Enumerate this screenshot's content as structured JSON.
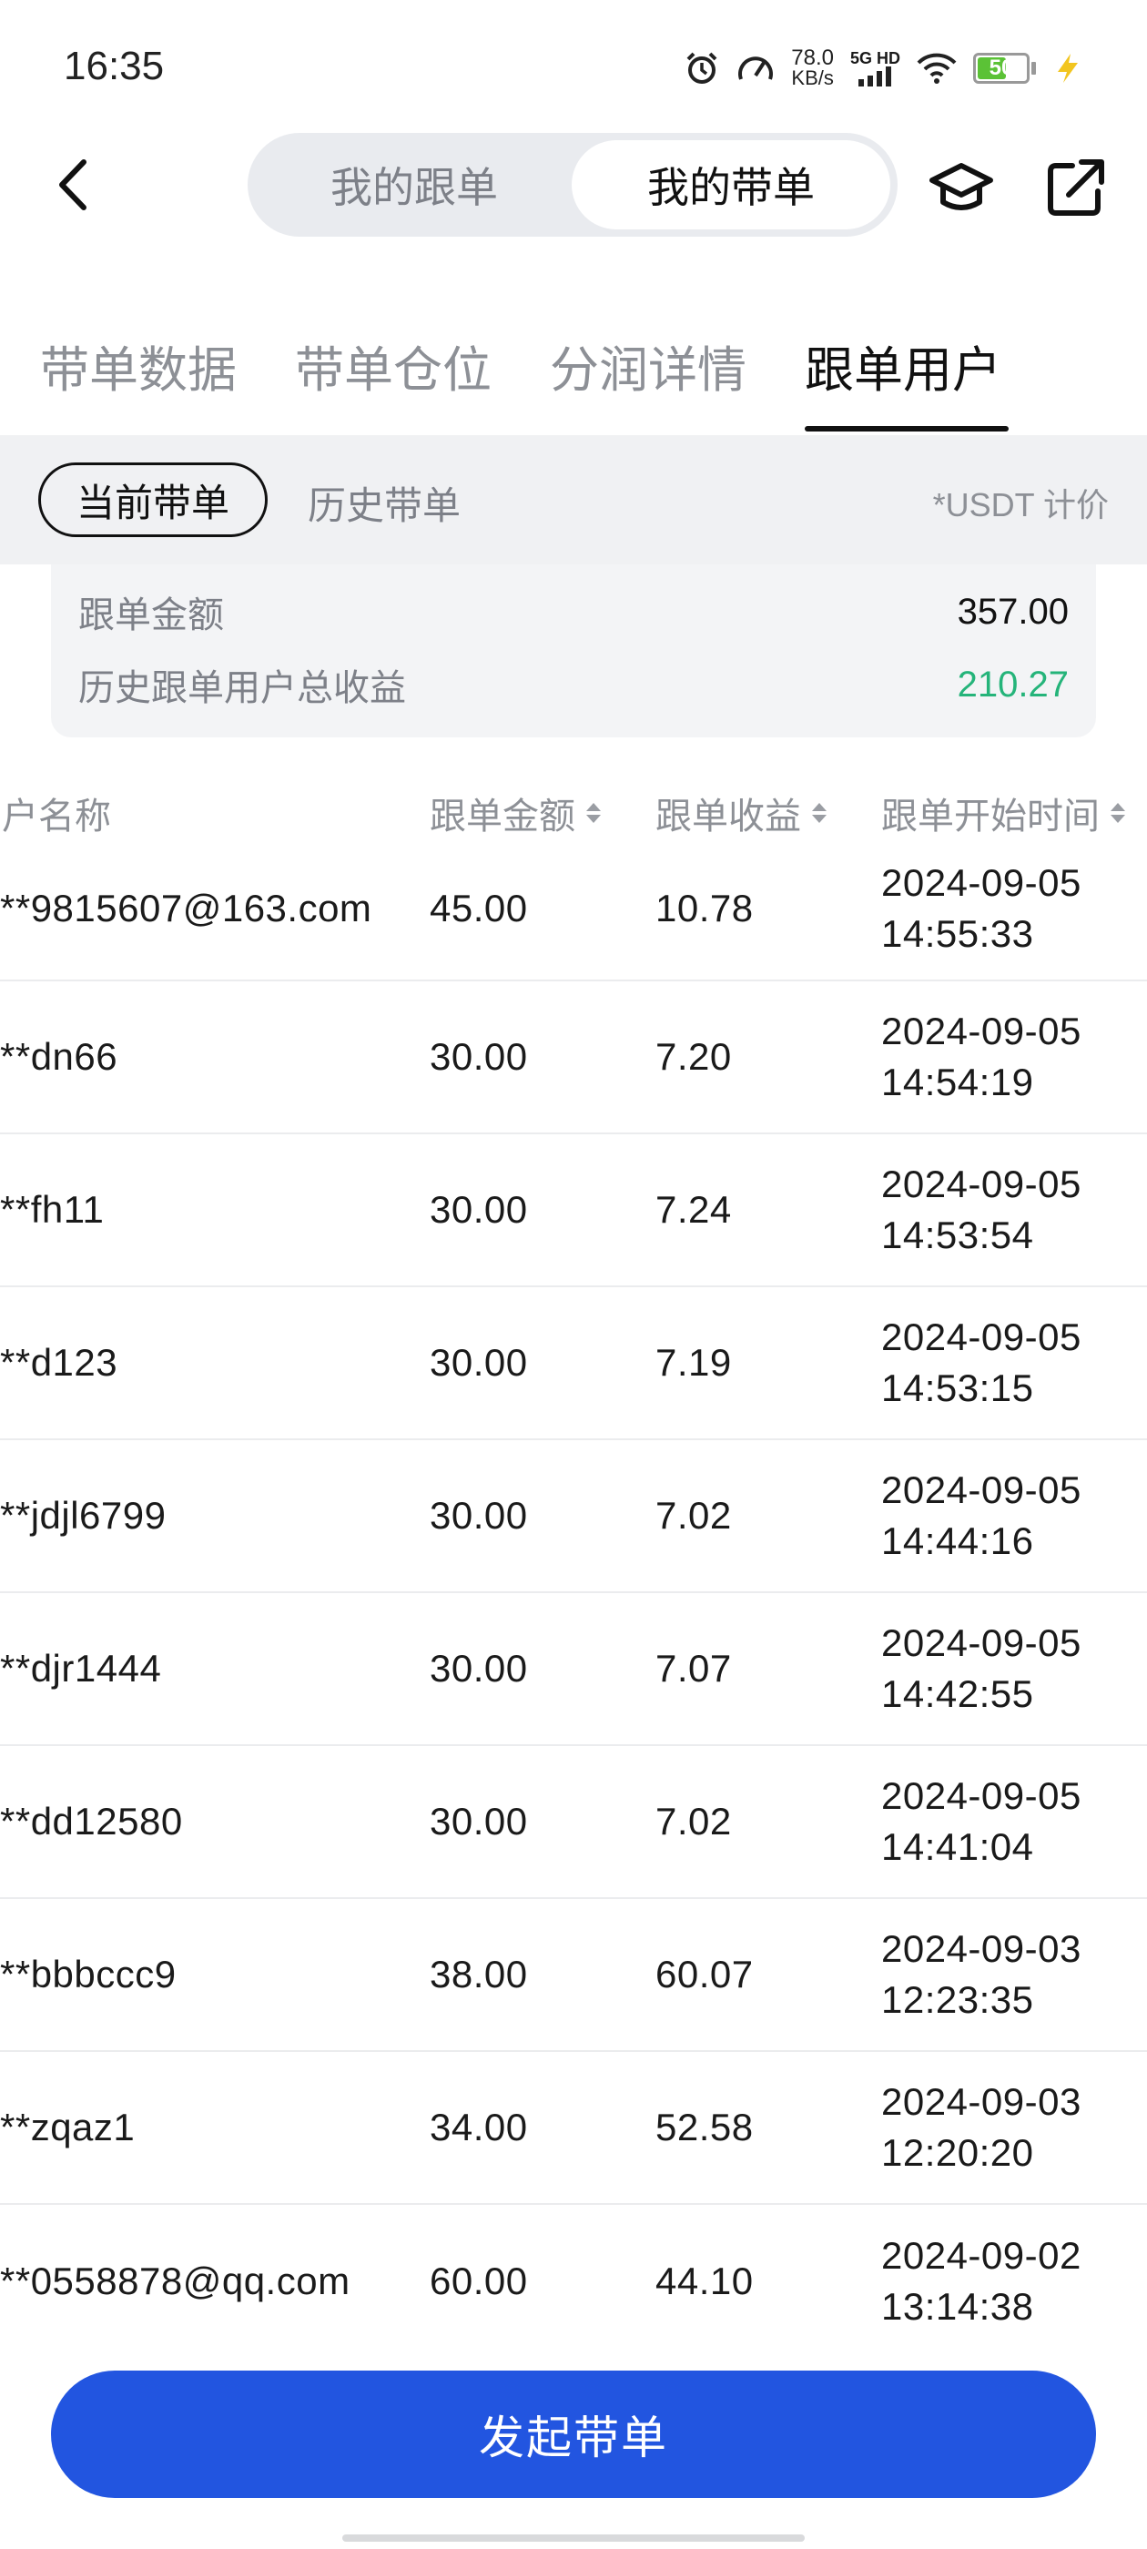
{
  "status_bar": {
    "time": "16:35",
    "net_speed_value": "78.0",
    "net_speed_unit": "KB/s",
    "network": "5G HD",
    "battery": "50"
  },
  "header": {
    "segment": [
      {
        "label": "我的跟单",
        "selected": false
      },
      {
        "label": "我的带单",
        "selected": true
      }
    ]
  },
  "tabs": [
    {
      "label": "带单数据",
      "active": false
    },
    {
      "label": "带单仓位",
      "active": false
    },
    {
      "label": "分润详情",
      "active": false
    },
    {
      "label": "跟单用户",
      "active": true
    }
  ],
  "filters": {
    "current": "当前带单",
    "history": "历史带单",
    "unit_note": "*USDT 计价"
  },
  "summary": {
    "follow_amount_label": "跟单金额",
    "follow_amount_value": "357.00",
    "total_profit_label": "历史跟单用户总收益",
    "total_profit_value": "210.27",
    "colors": {
      "profit": "#25b47a"
    }
  },
  "table": {
    "columns": [
      "用户名称",
      "跟单金额",
      "跟单收益",
      "跟单开始时间"
    ],
    "rows": [
      {
        "name": "**9815607@163.com",
        "amount": "45.00",
        "profit": "10.78",
        "date": "2024-09-05",
        "time": "14:55:33"
      },
      {
        "name": "**dn66",
        "amount": "30.00",
        "profit": "7.20",
        "date": "2024-09-05",
        "time": "14:54:19"
      },
      {
        "name": "**fh11",
        "amount": "30.00",
        "profit": "7.24",
        "date": "2024-09-05",
        "time": "14:53:54"
      },
      {
        "name": "**d123",
        "amount": "30.00",
        "profit": "7.19",
        "date": "2024-09-05",
        "time": "14:53:15"
      },
      {
        "name": "**jdjl6799",
        "amount": "30.00",
        "profit": "7.02",
        "date": "2024-09-05",
        "time": "14:44:16"
      },
      {
        "name": "**djr1444",
        "amount": "30.00",
        "profit": "7.07",
        "date": "2024-09-05",
        "time": "14:42:55"
      },
      {
        "name": "**dd12580",
        "amount": "30.00",
        "profit": "7.02",
        "date": "2024-09-05",
        "time": "14:41:04"
      },
      {
        "name": "**bbbccc9",
        "amount": "38.00",
        "profit": "60.07",
        "date": "2024-09-03",
        "time": "12:23:35"
      },
      {
        "name": "**zqaz1",
        "amount": "34.00",
        "profit": "52.58",
        "date": "2024-09-03",
        "time": "12:20:20"
      },
      {
        "name": "**0558878@qq.com",
        "amount": "60.00",
        "profit": "44.10",
        "date": "2024-09-02",
        "time": "13:14:38"
      }
    ]
  },
  "actions": {
    "start_copy": "发起带单",
    "colors": {
      "primary": "#2255e0"
    }
  }
}
